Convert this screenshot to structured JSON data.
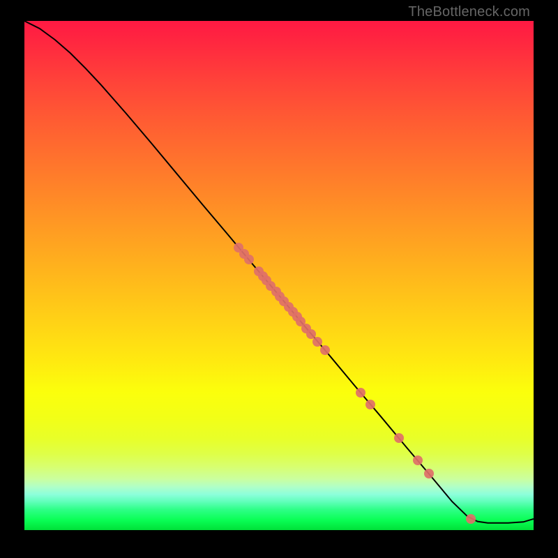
{
  "watermark": "TheBottleneck.com",
  "colors": {
    "point": "#e07068",
    "line": "#000000"
  },
  "chart_data": {
    "type": "line",
    "title": "",
    "xlabel": "",
    "ylabel": "",
    "xlim": [
      0,
      100
    ],
    "ylim": [
      0,
      100
    ],
    "grid": false,
    "line_points": [
      {
        "x": 0,
        "y": 100
      },
      {
        "x": 3,
        "y": 98.5
      },
      {
        "x": 6,
        "y": 96.3
      },
      {
        "x": 9,
        "y": 93.7
      },
      {
        "x": 12,
        "y": 90.7
      },
      {
        "x": 15,
        "y": 87.5
      },
      {
        "x": 20,
        "y": 81.8
      },
      {
        "x": 25,
        "y": 75.9
      },
      {
        "x": 30,
        "y": 69.9
      },
      {
        "x": 35,
        "y": 63.9
      },
      {
        "x": 40,
        "y": 58.0
      },
      {
        "x": 45,
        "y": 52.0
      },
      {
        "x": 50,
        "y": 46.1
      },
      {
        "x": 55,
        "y": 40.1
      },
      {
        "x": 60,
        "y": 34.2
      },
      {
        "x": 65,
        "y": 28.2
      },
      {
        "x": 70,
        "y": 22.3
      },
      {
        "x": 75,
        "y": 16.3
      },
      {
        "x": 80,
        "y": 10.4
      },
      {
        "x": 84,
        "y": 5.6
      },
      {
        "x": 87,
        "y": 2.7
      },
      {
        "x": 89,
        "y": 1.7
      },
      {
        "x": 91,
        "y": 1.4
      },
      {
        "x": 95,
        "y": 1.4
      },
      {
        "x": 98,
        "y": 1.6
      },
      {
        "x": 100,
        "y": 2.2
      }
    ],
    "series": [
      {
        "name": "markers",
        "points": [
          {
            "x": 42.0,
            "y": 55.5
          },
          {
            "x": 43.2,
            "y": 54.2
          },
          {
            "x": 44.1,
            "y": 53.1
          },
          {
            "x": 46.0,
            "y": 50.8
          },
          {
            "x": 46.8,
            "y": 49.9
          },
          {
            "x": 47.5,
            "y": 49.1
          },
          {
            "x": 48.4,
            "y": 48.0
          },
          {
            "x": 49.4,
            "y": 46.8
          },
          {
            "x": 50.2,
            "y": 45.9
          },
          {
            "x": 51.0,
            "y": 44.9
          },
          {
            "x": 51.9,
            "y": 43.8
          },
          {
            "x": 52.7,
            "y": 42.9
          },
          {
            "x": 53.5,
            "y": 41.9
          },
          {
            "x": 54.3,
            "y": 41.0
          },
          {
            "x": 55.4,
            "y": 39.6
          },
          {
            "x": 56.3,
            "y": 38.5
          },
          {
            "x": 57.6,
            "y": 37.0
          },
          {
            "x": 59.0,
            "y": 35.3
          },
          {
            "x": 66.0,
            "y": 27.0
          },
          {
            "x": 68.0,
            "y": 24.6
          },
          {
            "x": 73.5,
            "y": 18.1
          },
          {
            "x": 77.2,
            "y": 13.7
          },
          {
            "x": 79.4,
            "y": 11.1
          },
          {
            "x": 87.7,
            "y": 2.2
          }
        ]
      }
    ]
  }
}
